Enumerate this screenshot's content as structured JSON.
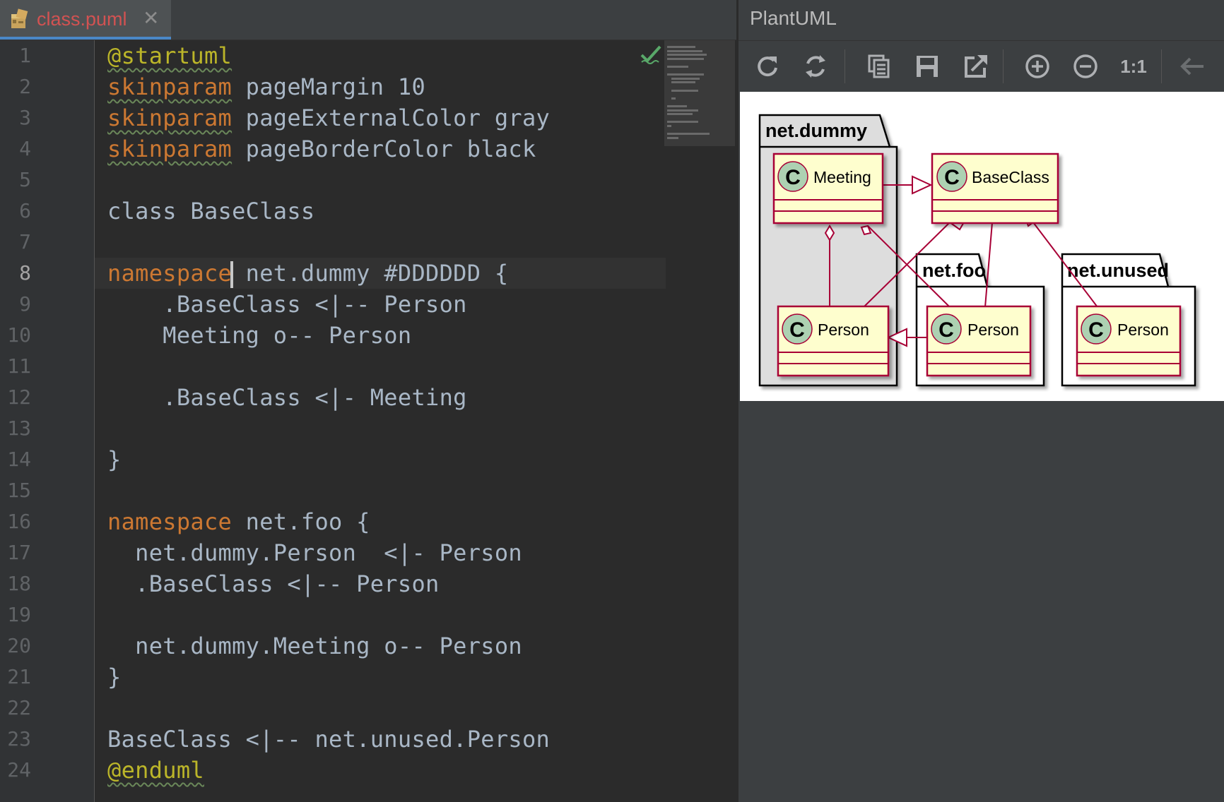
{
  "editor": {
    "tab": {
      "filename": "class.puml",
      "close_glyph": "✕",
      "icon": "puml-file-icon"
    },
    "current_line": 8,
    "line_numbers": [
      "1",
      "2",
      "3",
      "4",
      "5",
      "6",
      "7",
      "8",
      "9",
      "10",
      "11",
      "12",
      "13",
      "14",
      "15",
      "16",
      "17",
      "18",
      "19",
      "20",
      "21",
      "22",
      "23",
      "24"
    ],
    "lines": [
      [
        {
          "t": "@startuml",
          "c": "dir squig"
        }
      ],
      [
        {
          "t": "skinparam",
          "c": "kw squig"
        },
        {
          "t": " pageMargin 10"
        }
      ],
      [
        {
          "t": "skinparam",
          "c": "kw squig"
        },
        {
          "t": " pageExternalColor gray"
        }
      ],
      [
        {
          "t": "skinparam",
          "c": "kw squig"
        },
        {
          "t": " pageBorderColor black"
        }
      ],
      [],
      [
        {
          "t": "class BaseClass"
        }
      ],
      [],
      [
        {
          "t": "namespace",
          "c": "kw"
        },
        {
          "t": " net.dummy #DDDDDD {"
        }
      ],
      [
        {
          "t": "    .BaseClass <|-- Person"
        }
      ],
      [
        {
          "t": "    Meeting o-- Person"
        }
      ],
      [],
      [
        {
          "t": "    .BaseClass <|- Meeting"
        }
      ],
      [],
      [
        {
          "t": "}"
        }
      ],
      [],
      [
        {
          "t": "namespace",
          "c": "kw"
        },
        {
          "t": " net.foo {"
        }
      ],
      [
        {
          "t": "  net.dummy.Person  <|- Person"
        }
      ],
      [
        {
          "t": "  .BaseClass <|-- Person"
        }
      ],
      [],
      [
        {
          "t": "  net.dummy.Meeting o-- Person"
        }
      ],
      [
        {
          "t": "}"
        }
      ],
      [],
      [
        {
          "t": "BaseClass <|-- net.unused.Person"
        }
      ],
      [
        {
          "t": "@enduml",
          "c": "dir squig"
        }
      ]
    ],
    "status_icon": "check-icon"
  },
  "plantuml": {
    "title": "PlantUML",
    "toolbar": [
      {
        "name": "refresh-icon"
      },
      {
        "name": "sync-icon"
      },
      {
        "name": "copy-icon"
      },
      {
        "name": "save-icon"
      },
      {
        "name": "export-icon"
      },
      {
        "name": "zoom-in-icon"
      },
      {
        "name": "zoom-out-icon"
      },
      {
        "name": "actual-size-button",
        "label": "1:1"
      },
      {
        "name": "back-arrow-icon"
      }
    ],
    "diagram": {
      "packages": {
        "dummy": "net.dummy",
        "foo": "net.foo",
        "unused": "net.unused"
      },
      "classes": {
        "meeting": "Meeting",
        "baseclass": "BaseClass",
        "person_dummy": "Person",
        "person_foo": "Person",
        "person_unused": "Person"
      },
      "class_glyph": "C",
      "colors": {
        "class_fill": "#fefece",
        "class_border": "#a80036",
        "glyph_fill": "#add1b2",
        "package_fill_dummy": "#dddddd"
      }
    }
  }
}
